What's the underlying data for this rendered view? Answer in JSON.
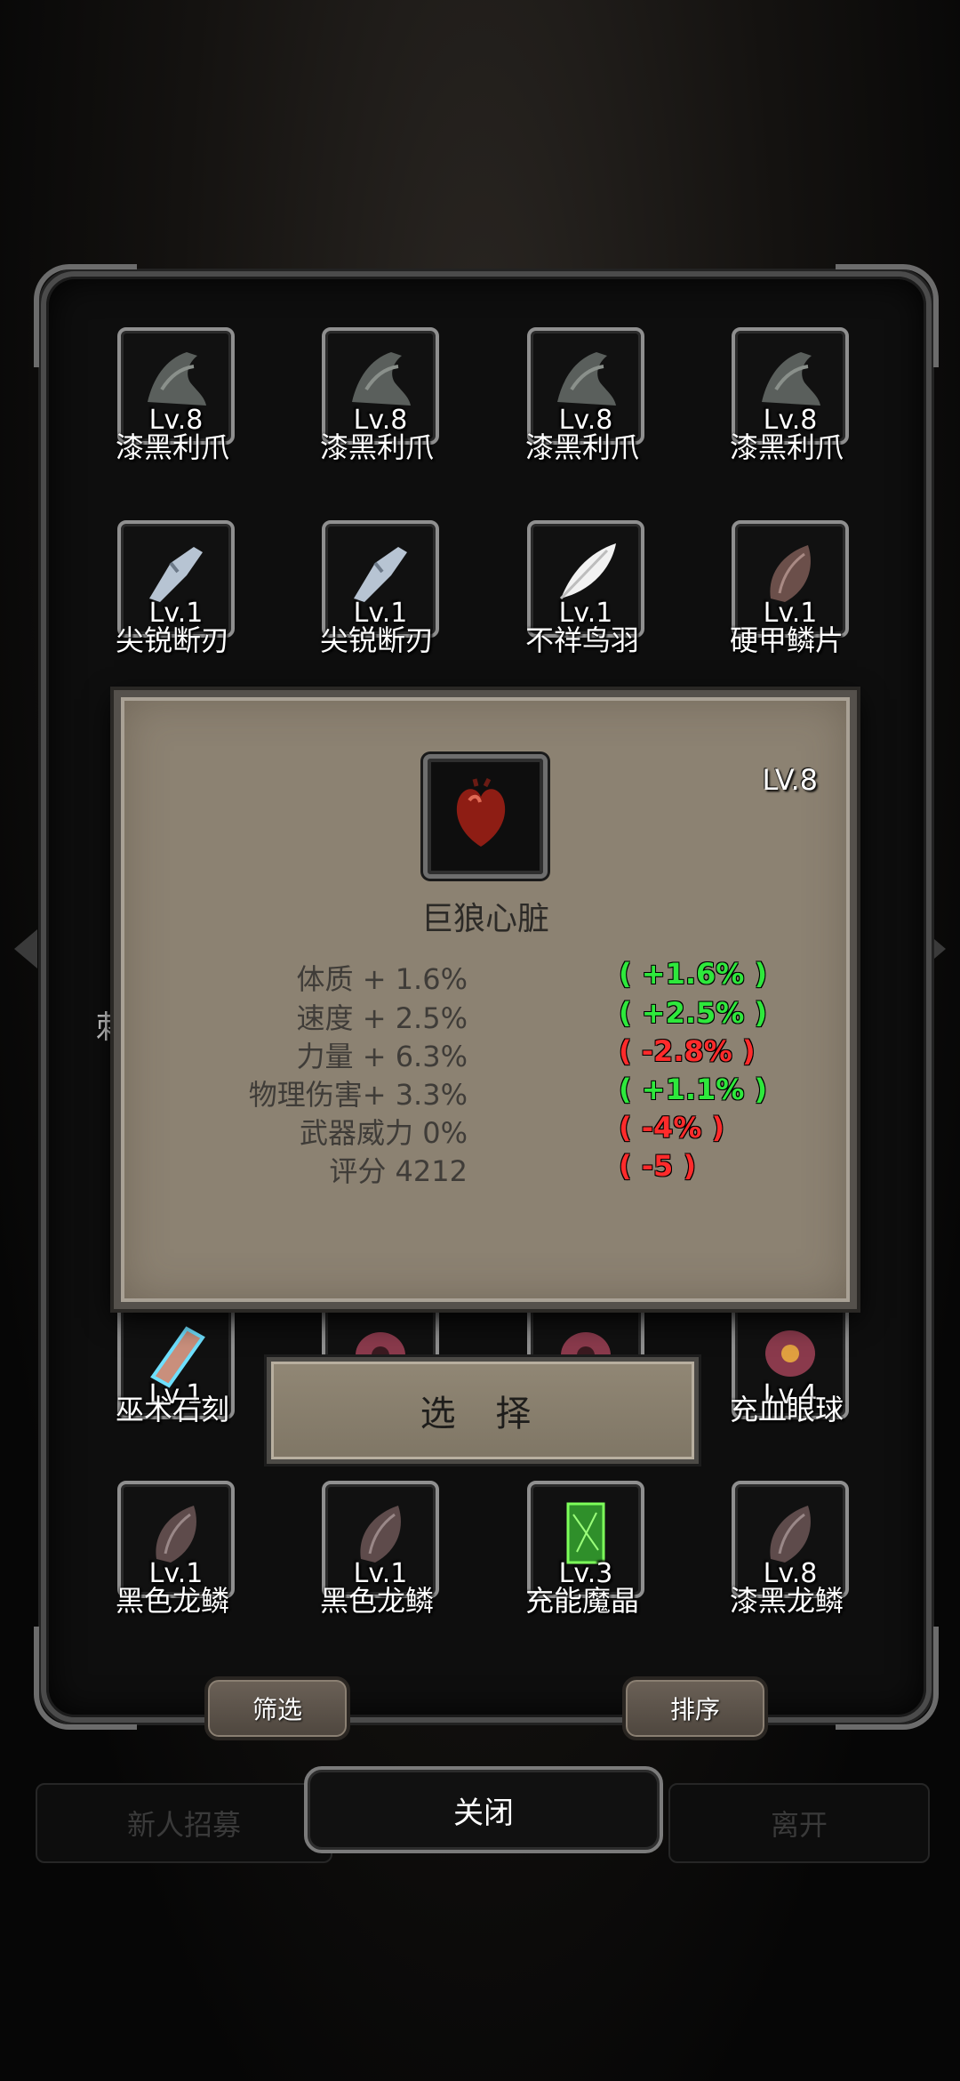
{
  "background_buttons": {
    "recruit": "新人招募",
    "leave": "离开"
  },
  "items": [
    {
      "name": "漆黑利爪",
      "level": "Lv.8",
      "icon": "claw-icon"
    },
    {
      "name": "漆黑利爪",
      "level": "Lv.8",
      "icon": "claw-icon"
    },
    {
      "name": "漆黑利爪",
      "level": "Lv.8",
      "icon": "claw-icon"
    },
    {
      "name": "漆黑利爪",
      "level": "Lv.8",
      "icon": "claw-icon"
    },
    {
      "name": "尖锐断刃",
      "level": "Lv.1",
      "icon": "broken-blade-icon"
    },
    {
      "name": "尖锐断刃",
      "level": "Lv.1",
      "icon": "broken-blade-icon"
    },
    {
      "name": "不祥鸟羽",
      "level": "Lv.1",
      "icon": "feather-icon"
    },
    {
      "name": "硬甲鳞片",
      "level": "Lv.1",
      "icon": "scale-icon"
    },
    {
      "name": "巫术石刻",
      "level": "Lv.1",
      "icon": "rune-stone-icon"
    },
    {
      "name": "",
      "level": "",
      "icon": "eyeball-icon"
    },
    {
      "name": "",
      "level": "",
      "icon": "eyeball-icon"
    },
    {
      "name": "充血眼球",
      "level": "Lv.4",
      "icon": "eyeball-icon"
    },
    {
      "name": "黑色龙鳞",
      "level": "Lv.1",
      "icon": "dragon-scale-icon"
    },
    {
      "name": "黑色龙鳞",
      "level": "Lv.1",
      "icon": "dragon-scale-icon"
    },
    {
      "name": "充能魔晶",
      "level": "Lv.3",
      "icon": "magic-crystal-icon"
    },
    {
      "name": "漆黑龙鳞",
      "level": "Lv.8",
      "icon": "dragon-scale-icon"
    }
  ],
  "partial_text": "刺",
  "detail": {
    "level": "LV.8",
    "name": "巨狼心脏",
    "icon": "heart-icon",
    "stats": [
      {
        "label": "体质 + 1.6%",
        "delta": "( +1.6% )",
        "trend": "up"
      },
      {
        "label": "速度 + 2.5%",
        "delta": "( +2.5% )",
        "trend": "up"
      },
      {
        "label": "力量 + 6.3%",
        "delta": "( -2.8% )",
        "trend": "down"
      },
      {
        "label": "物理伤害+ 3.3%",
        "delta": "( +1.1% )",
        "trend": "up"
      },
      {
        "label": "武器威力 0%",
        "delta": "( -4% )",
        "trend": "down"
      },
      {
        "label": "评分 4212",
        "delta": "( -5 )",
        "trend": "down"
      }
    ],
    "select_label": "选 择"
  },
  "buttons": {
    "filter": "筛选",
    "sort": "排序",
    "close": "关闭"
  },
  "colors": {
    "up": "#2ee83c",
    "down": "#ff2b2b",
    "popup_bg": "#8c8272"
  }
}
